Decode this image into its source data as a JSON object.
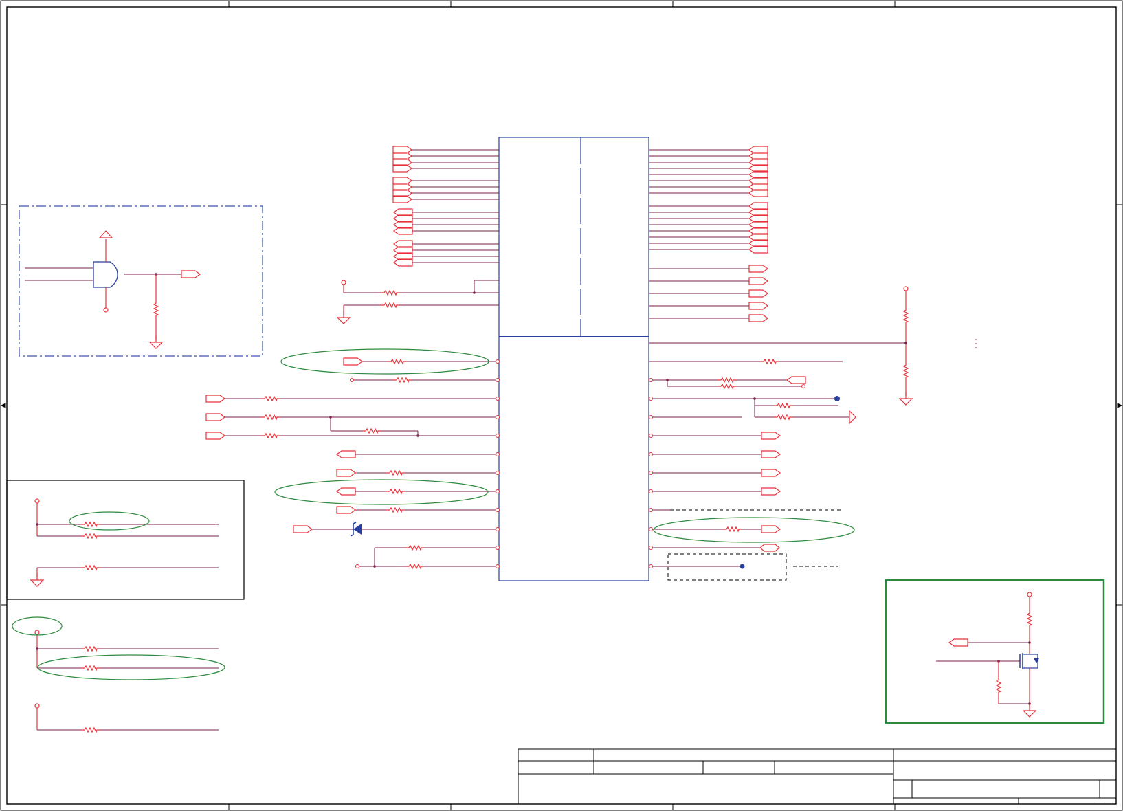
{
  "colors": {
    "wire": "#e8313a",
    "net": "#7a1f4a",
    "component": "#2a3f9e",
    "highlight": "#2e8b3e",
    "frame": "#000000",
    "dashed_box": "#3a55b0"
  },
  "icons": {
    "resistor": "resistor-icon",
    "ground": "ground-icon",
    "power_rail": "power-rail-icon",
    "port": "port-icon",
    "and_gate": "and-gate-icon",
    "diode": "diode-icon",
    "mosfet": "mosfet-icon",
    "junction": "junction-dot-icon"
  },
  "title_block": {
    "title": "",
    "company": "",
    "document_number": "",
    "revision": "",
    "size": "",
    "date": "",
    "sheet": ""
  }
}
